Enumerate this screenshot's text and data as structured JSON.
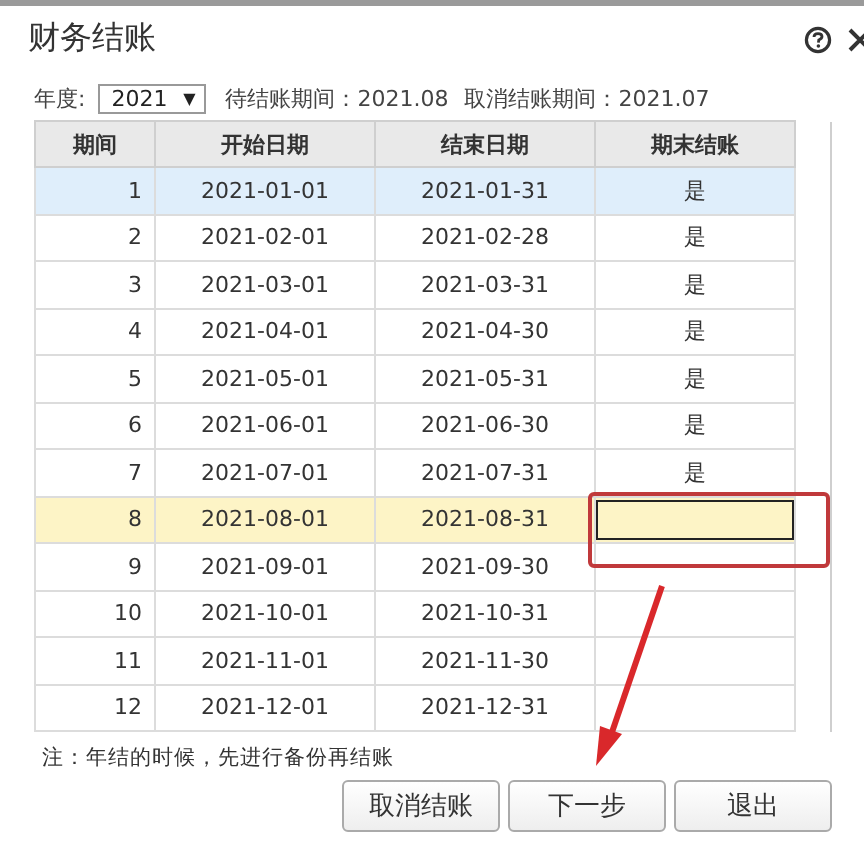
{
  "window": {
    "title": "财务结账"
  },
  "toolbar": {
    "year_label": "年度:",
    "year": "2021",
    "year_caret": "▼",
    "pending_period": "待结账期间：2021.08",
    "cancel_period": "取消结账期间：2021.07"
  },
  "table": {
    "columns": [
      "期间",
      "开始日期",
      "结束日期",
      "期末结账"
    ],
    "rows": [
      {
        "period": "1",
        "start": "2021-01-01",
        "end": "2021-01-31",
        "closed": "是",
        "selected": true,
        "current": false,
        "outlined": false
      },
      {
        "period": "2",
        "start": "2021-02-01",
        "end": "2021-02-28",
        "closed": "是",
        "selected": false,
        "current": false,
        "outlined": false
      },
      {
        "period": "3",
        "start": "2021-03-01",
        "end": "2021-03-31",
        "closed": "是",
        "selected": false,
        "current": false,
        "outlined": false
      },
      {
        "period": "4",
        "start": "2021-04-01",
        "end": "2021-04-30",
        "closed": "是",
        "selected": false,
        "current": false,
        "outlined": false
      },
      {
        "period": "5",
        "start": "2021-05-01",
        "end": "2021-05-31",
        "closed": "是",
        "selected": false,
        "current": false,
        "outlined": false
      },
      {
        "period": "6",
        "start": "2021-06-01",
        "end": "2021-06-30",
        "closed": "是",
        "selected": false,
        "current": false,
        "outlined": false
      },
      {
        "period": "7",
        "start": "2021-07-01",
        "end": "2021-07-31",
        "closed": "是",
        "selected": false,
        "current": false,
        "outlined": false
      },
      {
        "period": "8",
        "start": "2021-08-01",
        "end": "2021-08-31",
        "selected": false,
        "current": true,
        "outlined": true
      },
      {
        "period": "9",
        "start": "2021-09-01",
        "end": "2021-09-30",
        "selected": false,
        "current": false,
        "outlined": false
      },
      {
        "period": "10",
        "start": "2021-10-01",
        "end": "2021-10-31",
        "selected": false,
        "current": false,
        "outlined": false
      },
      {
        "period": "11",
        "start": "2021-11-01",
        "end": "2021-11-30",
        "selected": false,
        "current": false,
        "outlined": false
      },
      {
        "period": "12",
        "start": "2021-12-01",
        "end": "2021-12-31",
        "selected": false,
        "current": false,
        "outlined": false
      }
    ]
  },
  "note": "注：年结的时候，先进行备份再结账",
  "buttons": [
    {
      "label": "取消结账"
    },
    {
      "label": "下一步"
    },
    {
      "label": "退出"
    }
  ]
}
